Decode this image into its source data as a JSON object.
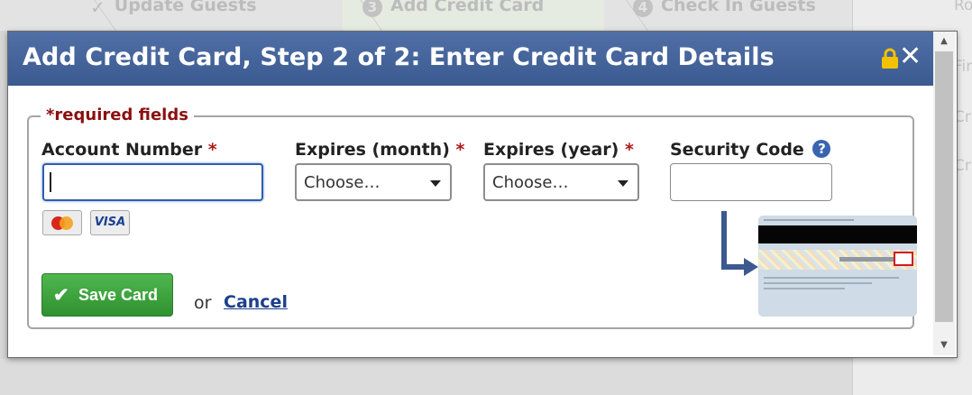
{
  "background_steps": [
    {
      "label": "Update Guests",
      "marker": "✓"
    },
    {
      "label": "Add Credit Card",
      "marker": "3"
    },
    {
      "label": "Check In Guests",
      "marker": "4"
    }
  ],
  "background_right_fragments": [
    "Ro",
    "Fir",
    "Cr",
    "Cr"
  ],
  "dialog": {
    "title": "Add Credit Card, Step 2 of 2: Enter Credit Card Details",
    "close_glyph": "✕",
    "required_legend": "*required fields",
    "fields": {
      "account_number": {
        "label": "Account Number",
        "required_mark": "*",
        "value": ""
      },
      "expires_month": {
        "label": "Expires (month)",
        "required_mark": "*",
        "selected": "Choose…"
      },
      "expires_year": {
        "label": "Expires (year)",
        "required_mark": "*",
        "selected": "Choose…"
      },
      "security_code": {
        "label": "Security Code",
        "help_glyph": "?",
        "value": ""
      }
    },
    "card_icons": {
      "visa_text": "VISA"
    },
    "save_button": {
      "check": "✔",
      "label": "Save Card"
    },
    "or_text": "or",
    "cancel_link": "Cancel"
  },
  "colors": {
    "title_bar": "#3b5a90",
    "required_red": "#b01818",
    "save_green": "#2f912f",
    "link_blue": "#1c3f8a"
  }
}
